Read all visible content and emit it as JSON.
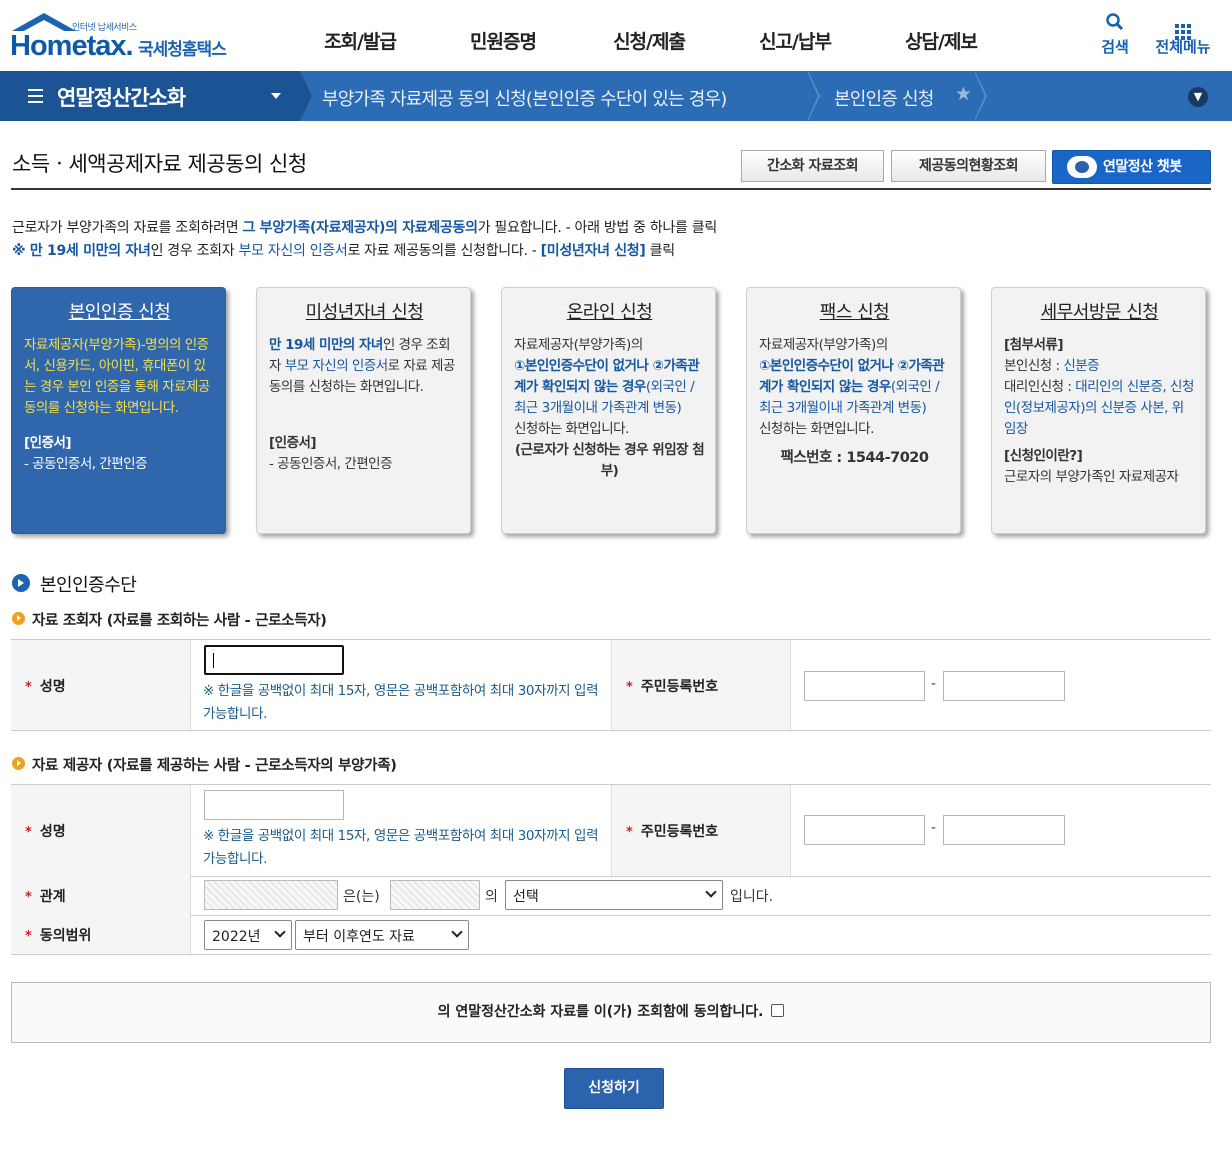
{
  "logo": {
    "subtitle": "인터넷 납세서비스",
    "brand_en": "Hometax.",
    "brand_kr": "국세청홈택스"
  },
  "gnb": [
    "조회/발급",
    "민원증명",
    "신청/제출",
    "신고/납부",
    "상담/제보"
  ],
  "util": {
    "search": "검색",
    "menu": "전체메뉴"
  },
  "breadcrumb": {
    "home": "연말정산간소화",
    "level2": "부양가족 자료제공 동의 신청(본인인증 수단이 있는 경우)",
    "level3": "본인인증 신청"
  },
  "page_title": "소득ㆍ세액공제자료 제공동의 신청",
  "buttons": {
    "simple_query": "간소화 자료조회",
    "status_query": "제공동의현황조회",
    "chatbot": "연말정산 챗봇",
    "submit": "신청하기"
  },
  "intro": {
    "line1_a": "근로자가 부양가족의 자료를 조회하려면 ",
    "line1_b": "그 부양가족(자료제공자)의 자료제공동의",
    "line1_c": "가 필요합니다. - 아래 방법 중 하나를 클릭",
    "line2_a": "※ 만 19세 미만의 자녀",
    "line2_b": "인 경우 조회자 ",
    "line2_c": "부모 자신의 인증서",
    "line2_d": "로 자료 제공동의를 신청합니다. - ",
    "line2_e": "[미성년자녀 신청]",
    "line2_f": " 클릭"
  },
  "cards": [
    {
      "title": "본인인증 신청",
      "desc": "자료제공자(부양가족)-명의의 인증서, 신용카드, 아이핀, 휴대폰이 있는 경우 본인 인증을 통해 자료제공동의를 신청하는 화면입니다.",
      "cert_label": "[인증서]",
      "cert_value": "- 공동인증서, 간편인증"
    },
    {
      "title": "미성년자녀 신청",
      "desc_a": "만 19세 미만의 자녀",
      "desc_b": "인 경우 조회자 ",
      "desc_c": "부모 자신의 인증서",
      "desc_d": "로 자료 제공 동의를 신청하는 화면입니다.",
      "cert_label": "[인증서]",
      "cert_value": "- 공동인증서, 간편인증"
    },
    {
      "title": "온라인 신청",
      "desc_a": "자료제공자(부양가족)의",
      "desc_b": "①본인인증수단이 없거나 ②가족관계가 확인되지 않는 경우",
      "desc_c": "(외국인 / 최근 ",
      "desc_d": "3개월이내 가족관계 변동)",
      "desc_e": "신청하는 화면입니다.",
      "desc_f": "(근로자가 신청하는 경우 위임장 첨부)"
    },
    {
      "title": "팩스 신청",
      "desc_a": "자료제공자(부양가족)의",
      "desc_b": "①본인인증수단이 없거나 ②가족관계가 확인되지 않는 경우",
      "desc_c": "(외국인 / 최근 ",
      "desc_d": "3개월이내 가족관계 변동)",
      "desc_e": "신청하는 화면입니다.",
      "fax": "팩스번호 : 1544-7020"
    },
    {
      "title": "세무서방문 신청",
      "docs_label": "[첨부서류]",
      "self_a": "본인신청 : ",
      "self_b": "신분증",
      "agent_a": "대리인신청 : ",
      "agent_b": "대리인의 신분증, 신청인(정보제공자)의 신분증 사본, 위임장",
      "who_label": "[신청인이란?]",
      "who_value": "근로자의 부양가족인 자료제공자"
    }
  ],
  "section_title": "본인인증수단",
  "requester": {
    "title": "자료 조회자 (자료를 조회하는 사람 - 근로소득자)",
    "name_label": "성명",
    "name_value": "",
    "note": "※ 한글을 공백없이 최대 15자, 영문은 공백포함하여 최대 30자까지 입력가능합니다.",
    "rrn_label": "주민등록번호",
    "rrn_front": "",
    "rrn_back": ""
  },
  "provider": {
    "title": "자료 제공자 (자료를 제공하는 사람 - 근로소득자의 부양가족)",
    "name_label": "성명",
    "name_value": "",
    "note": "※ 한글을 공백없이 최대 15자, 영문은 공백포함하여 최대 30자까지 입력가능합니다.",
    "rrn_label": "주민등록번호",
    "rrn_front": "",
    "rrn_back": "",
    "relation_label": "관계",
    "relation_eun": "은(는)",
    "relation_ui": "의",
    "relation_select": "선택",
    "relation_end": "입니다.",
    "scope_label": "동의범위",
    "scope_year": "2022년",
    "scope_range": "부터 이후연도 자료"
  },
  "agree_text": "의 연말정산간소화 자료를 이(가) 조회함에 동의합니다."
}
